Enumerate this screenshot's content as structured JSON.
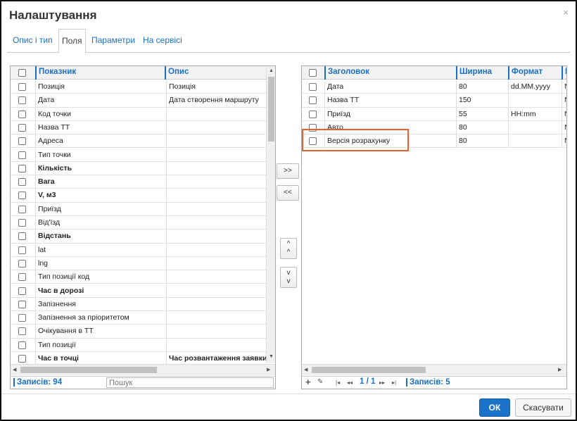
{
  "dialog": {
    "title": "Налаштування",
    "close": "×"
  },
  "tabs": [
    "Опис і тип",
    "Поля",
    "Параметри",
    "На сервісі"
  ],
  "left_grid": {
    "columns": [
      "Показник",
      "Опис"
    ],
    "rows": [
      {
        "name": "Позиція",
        "desc": "Позиція",
        "bold": false
      },
      {
        "name": "Дата",
        "desc": "Дата створення маршруту",
        "bold": false
      },
      {
        "name": "Код точки",
        "desc": "",
        "bold": false
      },
      {
        "name": "Назва ТТ",
        "desc": "",
        "bold": false
      },
      {
        "name": "Адреса",
        "desc": "",
        "bold": false
      },
      {
        "name": "Тип точки",
        "desc": "",
        "bold": false
      },
      {
        "name": "Кількість",
        "desc": "",
        "bold": true
      },
      {
        "name": "Вага",
        "desc": "",
        "bold": true
      },
      {
        "name": "V, м3",
        "desc": "",
        "bold": true
      },
      {
        "name": "Приїзд",
        "desc": "",
        "bold": false
      },
      {
        "name": "Від'їзд",
        "desc": "",
        "bold": false
      },
      {
        "name": "Відстань",
        "desc": "",
        "bold": true
      },
      {
        "name": "lat",
        "desc": "",
        "bold": false
      },
      {
        "name": "lng",
        "desc": "",
        "bold": false
      },
      {
        "name": "Тип позиції код",
        "desc": "",
        "bold": false
      },
      {
        "name": "Час в дорозі",
        "desc": "",
        "bold": true
      },
      {
        "name": "Запізнення",
        "desc": "",
        "bold": false
      },
      {
        "name": "Запізнення за пріоритетом",
        "desc": "",
        "bold": false
      },
      {
        "name": "Очікування в ТТ",
        "desc": "",
        "bold": false
      },
      {
        "name": "Тип позиції",
        "desc": "",
        "bold": false
      },
      {
        "name": "Час в точці",
        "desc": "Час розвантаження заявки :",
        "bold": true
      }
    ],
    "count_label": "Записів: 94",
    "search_placeholder": "Пошук"
  },
  "right_grid": {
    "columns": [
      "Заголовок",
      "Ширина",
      "Формат",
      "I"
    ],
    "rows": [
      {
        "title": "Дата",
        "width": "80",
        "format": "dd.MM.yyyy",
        "extra": "N"
      },
      {
        "title": "Назва ТТ",
        "width": "150",
        "format": "",
        "extra": "N"
      },
      {
        "title": "Приїзд",
        "width": "55",
        "format": "HH:mm",
        "extra": "N"
      },
      {
        "title": "Авто",
        "width": "80",
        "format": "",
        "extra": "N"
      },
      {
        "title": "Версія розрахунку",
        "width": "80",
        "format": "",
        "extra": "N"
      }
    ],
    "toolbar": {
      "add": "+",
      "edit": "✎",
      "first": "|◂",
      "prev": "◂◂",
      "page": "1 / 1",
      "next": "▸▸",
      "last": "▸|"
    },
    "count_label": "Записів: 5"
  },
  "move_buttons": {
    "add": ">>",
    "remove": "<<",
    "up": "^",
    "down": "v"
  },
  "actions": {
    "ok": "ОК",
    "cancel": "Скасувати"
  }
}
